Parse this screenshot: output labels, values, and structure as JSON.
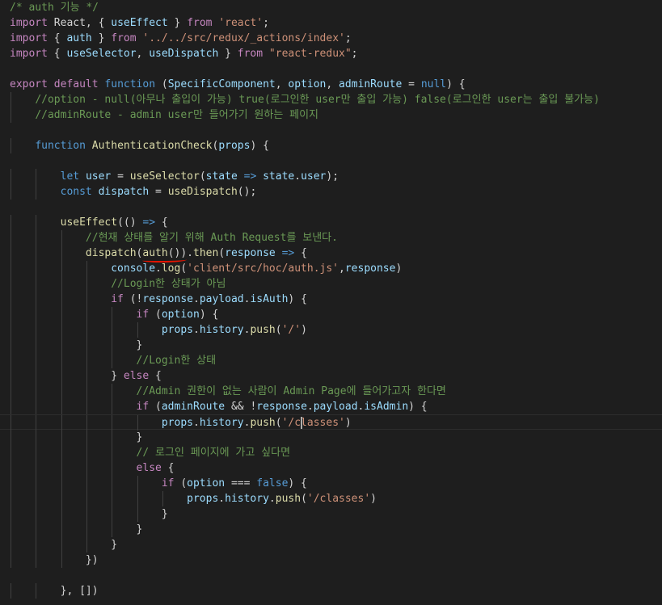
{
  "editor": {
    "lines": [
      [
        [
          "/* auth 기능 */",
          "m"
        ]
      ],
      [
        [
          "import",
          "c"
        ],
        [
          " React, { ",
          "p"
        ],
        [
          "useEffect",
          "v"
        ],
        [
          " } ",
          "p"
        ],
        [
          "from",
          "c"
        ],
        [
          " ",
          "p"
        ],
        [
          "'react'",
          "s"
        ],
        [
          ";",
          "p"
        ]
      ],
      [
        [
          "import",
          "c"
        ],
        [
          " { ",
          "p"
        ],
        [
          "auth",
          "v"
        ],
        [
          " } ",
          "p"
        ],
        [
          "from",
          "c"
        ],
        [
          " ",
          "p"
        ],
        [
          "'../../src/redux/_actions/index'",
          "s"
        ],
        [
          ";",
          "p"
        ]
      ],
      [
        [
          "import",
          "c"
        ],
        [
          " { ",
          "p"
        ],
        [
          "useSelector",
          "v"
        ],
        [
          ", ",
          "p"
        ],
        [
          "useDispatch",
          "v"
        ],
        [
          " } ",
          "p"
        ],
        [
          "from",
          "c"
        ],
        [
          " ",
          "p"
        ],
        [
          "\"react-redux\"",
          "s"
        ],
        [
          ";",
          "p"
        ]
      ],
      [],
      [
        [
          "export",
          "c"
        ],
        [
          " ",
          "p"
        ],
        [
          "default",
          "c"
        ],
        [
          " ",
          "p"
        ],
        [
          "function",
          "k"
        ],
        [
          " (",
          "p"
        ],
        [
          "SpecificComponent",
          "v"
        ],
        [
          ", ",
          "p"
        ],
        [
          "option",
          "v"
        ],
        [
          ", ",
          "p"
        ],
        [
          "adminRoute",
          "v"
        ],
        [
          " = ",
          "p"
        ],
        [
          "null",
          "k"
        ],
        [
          ") {",
          "p"
        ]
      ],
      [
        [
          "    ",
          "p"
        ],
        [
          "//option - null(아무나 출입이 가능) true(로그인한 user만 출입 가능) false(로그인한 user는 출입 불가능)",
          "m"
        ]
      ],
      [
        [
          "    ",
          "p"
        ],
        [
          "//adminRoute - admin user만 들어가기 원하는 페이지",
          "m"
        ]
      ],
      [],
      [
        [
          "    ",
          "p"
        ],
        [
          "function",
          "k"
        ],
        [
          " ",
          "p"
        ],
        [
          "AuthenticationCheck",
          "f"
        ],
        [
          "(",
          "p"
        ],
        [
          "props",
          "v"
        ],
        [
          ") {",
          "p"
        ]
      ],
      [],
      [
        [
          "        ",
          "p"
        ],
        [
          "let",
          "k"
        ],
        [
          " ",
          "p"
        ],
        [
          "user",
          "v"
        ],
        [
          " = ",
          "p"
        ],
        [
          "useSelector",
          "f"
        ],
        [
          "(",
          "p"
        ],
        [
          "state",
          "v"
        ],
        [
          " ",
          "p"
        ],
        [
          "=>",
          "k"
        ],
        [
          " ",
          "p"
        ],
        [
          "state",
          "v"
        ],
        [
          ".",
          "p"
        ],
        [
          "user",
          "v"
        ],
        [
          ");",
          "p"
        ]
      ],
      [
        [
          "        ",
          "p"
        ],
        [
          "const",
          "k"
        ],
        [
          " ",
          "p"
        ],
        [
          "dispatch",
          "v"
        ],
        [
          " = ",
          "p"
        ],
        [
          "useDispatch",
          "f"
        ],
        [
          "();",
          "p"
        ]
      ],
      [],
      [
        [
          "        ",
          "p"
        ],
        [
          "useEffect",
          "f"
        ],
        [
          "(() ",
          "p"
        ],
        [
          "=>",
          "k"
        ],
        [
          " {",
          "p"
        ]
      ],
      [
        [
          "            ",
          "p"
        ],
        [
          "//현재 상태를 알기 위해 Auth Request를 보낸다.",
          "m"
        ]
      ],
      [
        [
          "            ",
          "p"
        ],
        [
          "dispatch",
          "f"
        ],
        [
          "(",
          "p"
        ],
        [
          "auth",
          "f"
        ],
        [
          "()).",
          "p"
        ],
        [
          "then",
          "f"
        ],
        [
          "(",
          "p"
        ],
        [
          "response",
          "v"
        ],
        [
          " ",
          "p"
        ],
        [
          "=>",
          "k"
        ],
        [
          " {",
          "p"
        ]
      ],
      [
        [
          "                ",
          "p"
        ],
        [
          "console",
          "v"
        ],
        [
          ".",
          "p"
        ],
        [
          "log",
          "f"
        ],
        [
          "(",
          "p"
        ],
        [
          "'client/src/hoc/auth.js'",
          "s"
        ],
        [
          ",",
          "p"
        ],
        [
          "response",
          "v"
        ],
        [
          ")",
          "p"
        ]
      ],
      [
        [
          "                ",
          "p"
        ],
        [
          "//Login한 상태가 아님",
          "m"
        ]
      ],
      [
        [
          "                ",
          "p"
        ],
        [
          "if",
          "c"
        ],
        [
          " (!",
          "p"
        ],
        [
          "response",
          "v"
        ],
        [
          ".",
          "p"
        ],
        [
          "payload",
          "v"
        ],
        [
          ".",
          "p"
        ],
        [
          "isAuth",
          "v"
        ],
        [
          ") {",
          "p"
        ]
      ],
      [
        [
          "                    ",
          "p"
        ],
        [
          "if",
          "c"
        ],
        [
          " (",
          "p"
        ],
        [
          "option",
          "v"
        ],
        [
          ") {",
          "p"
        ]
      ],
      [
        [
          "                        ",
          "p"
        ],
        [
          "props",
          "v"
        ],
        [
          ".",
          "p"
        ],
        [
          "history",
          "v"
        ],
        [
          ".",
          "p"
        ],
        [
          "push",
          "f"
        ],
        [
          "(",
          "p"
        ],
        [
          "'/'",
          "s"
        ],
        [
          ")",
          "p"
        ]
      ],
      [
        [
          "                    ",
          "p"
        ],
        [
          "}",
          "p"
        ]
      ],
      [
        [
          "                    ",
          "p"
        ],
        [
          "//Login한 상태",
          "m"
        ]
      ],
      [
        [
          "                ",
          "p"
        ],
        [
          "} ",
          "p"
        ],
        [
          "else",
          "c"
        ],
        [
          " {",
          "p"
        ]
      ],
      [
        [
          "                    ",
          "p"
        ],
        [
          "//Admin 권한이 없는 사람이 Admin Page에 들어가고자 한다면",
          "m"
        ]
      ],
      [
        [
          "                    ",
          "p"
        ],
        [
          "if",
          "c"
        ],
        [
          " (",
          "p"
        ],
        [
          "adminRoute",
          "v"
        ],
        [
          " && !",
          "p"
        ],
        [
          "response",
          "v"
        ],
        [
          ".",
          "p"
        ],
        [
          "payload",
          "v"
        ],
        [
          ".",
          "p"
        ],
        [
          "isAdmin",
          "v"
        ],
        [
          ") {",
          "p"
        ]
      ],
      [
        [
          "                        ",
          "p"
        ],
        [
          "props",
          "v"
        ],
        [
          ".",
          "p"
        ],
        [
          "history",
          "v"
        ],
        [
          ".",
          "p"
        ],
        [
          "push",
          "f"
        ],
        [
          "(",
          "p"
        ],
        [
          "'/classes'",
          "s"
        ],
        [
          ")",
          "p"
        ]
      ],
      [
        [
          "                    ",
          "p"
        ],
        [
          "}",
          "p"
        ]
      ],
      [
        [
          "                    ",
          "p"
        ],
        [
          "// 로그인 페이지에 가고 싶다면",
          "m"
        ]
      ],
      [
        [
          "                    ",
          "p"
        ],
        [
          "else",
          "c"
        ],
        [
          " {",
          "p"
        ]
      ],
      [
        [
          "                        ",
          "p"
        ],
        [
          "if",
          "c"
        ],
        [
          " (",
          "p"
        ],
        [
          "option",
          "v"
        ],
        [
          " === ",
          "p"
        ],
        [
          "false",
          "k"
        ],
        [
          ") {",
          "p"
        ]
      ],
      [
        [
          "                            ",
          "p"
        ],
        [
          "props",
          "v"
        ],
        [
          ".",
          "p"
        ],
        [
          "history",
          "v"
        ],
        [
          ".",
          "p"
        ],
        [
          "push",
          "f"
        ],
        [
          "(",
          "p"
        ],
        [
          "'/classes'",
          "s"
        ],
        [
          ")",
          "p"
        ]
      ],
      [
        [
          "                        ",
          "p"
        ],
        [
          "}",
          "p"
        ]
      ],
      [
        [
          "                    ",
          "p"
        ],
        [
          "}",
          "p"
        ]
      ],
      [
        [
          "                ",
          "p"
        ],
        [
          "}",
          "p"
        ]
      ],
      [
        [
          "            ",
          "p"
        ],
        [
          "})",
          "p"
        ]
      ],
      [],
      [
        [
          "        ",
          "p"
        ],
        [
          "}, [])",
          "p"
        ]
      ]
    ]
  }
}
